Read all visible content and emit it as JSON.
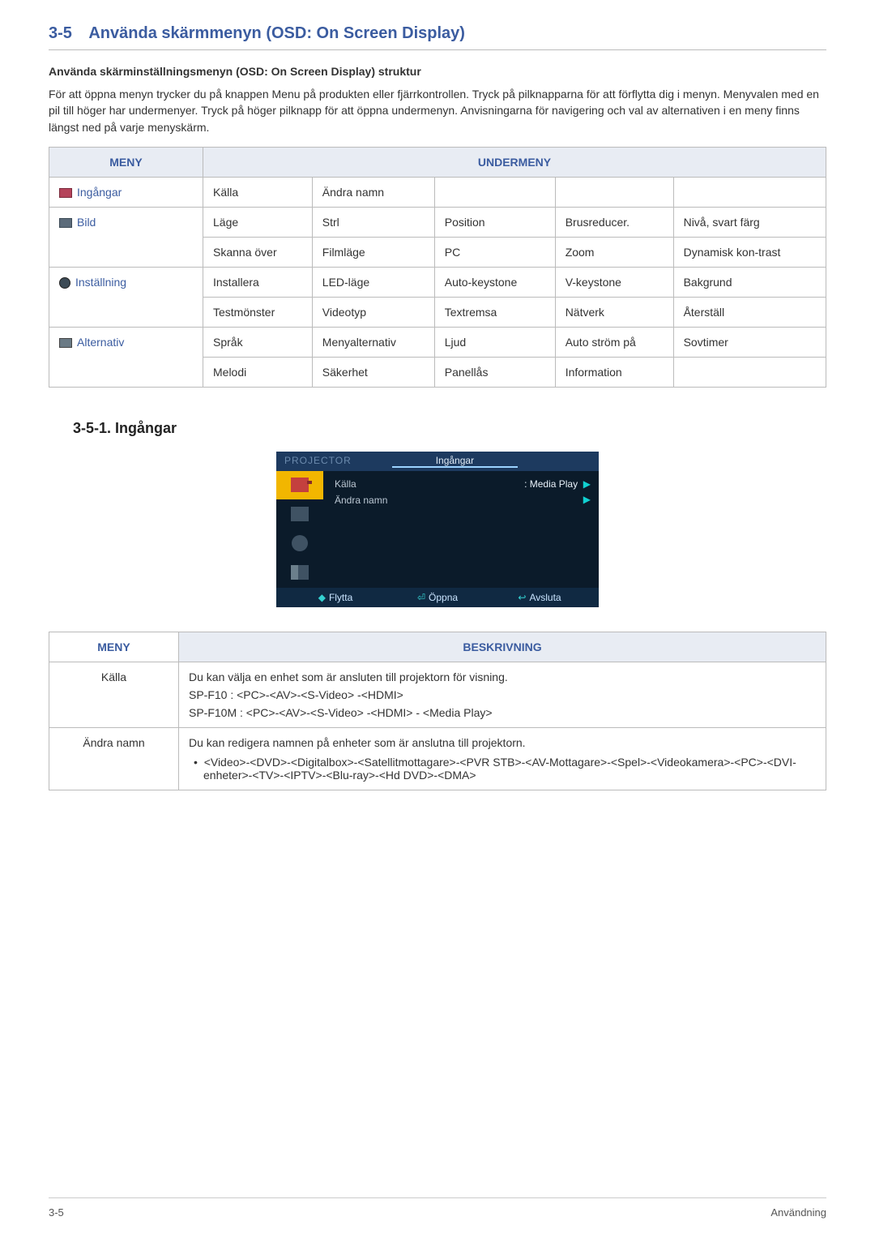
{
  "header": {
    "section_num": "3-5",
    "title": "Använda skärmmenyn (OSD: On Screen Display)"
  },
  "intro": {
    "sub_heading": "Använda skärminställningsmenyn (OSD: On Screen Display) struktur",
    "paragraph": "För att öppna menyn trycker du på knappen Menu på produkten eller fjärrkontrollen. Tryck på pilknapparna för att förflytta dig i menyn. Menyvalen med en pil till höger har undermenyer. Tryck på höger pilknapp för att öppna undermenyn. Anvisningarna för navigering och val av alternativen i en meny finns längst ned på varje menyskärm."
  },
  "table1": {
    "col_menu": "MENY",
    "col_sub": "UNDERMENY",
    "rows": [
      {
        "menu": "Ingångar",
        "c": [
          "Källa",
          "Ändra namn",
          "",
          "",
          ""
        ]
      },
      {
        "menu": "Bild",
        "c": [
          "Läge",
          "Strl",
          "Position",
          "Brusreducer.",
          "Nivå, svart färg"
        ]
      },
      {
        "menu": "",
        "c": [
          "Skanna över",
          "Filmläge",
          "PC",
          "Zoom",
          "Dynamisk kon-trast"
        ]
      },
      {
        "menu": "Inställning",
        "c": [
          "Installera",
          "LED-läge",
          "Auto-keystone",
          "V-keystone",
          "Bakgrund"
        ]
      },
      {
        "menu": "",
        "c": [
          "Testmönster",
          "Videotyp",
          "Textremsa",
          "Nätverk",
          "Återställ"
        ]
      },
      {
        "menu": "Alternativ",
        "c": [
          "Språk",
          "Menyalternativ",
          "Ljud",
          "Auto ström på",
          "Sovtimer"
        ]
      },
      {
        "menu": "",
        "c": [
          "Melodi",
          "Säkerhet",
          "Panellås",
          "Information",
          ""
        ]
      }
    ]
  },
  "section2": {
    "heading": "3-5-1. Ingångar"
  },
  "osd": {
    "projector": "PROJECTOR",
    "tab": "Ingångar",
    "line1_label": "Källa",
    "line1_value": ": Media Play",
    "line2_label": "Ändra namn",
    "foot_move": "Flytta",
    "foot_open": "Öppna",
    "foot_exit": "Avsluta"
  },
  "table2": {
    "col_menu": "MENY",
    "col_desc": "BESKRIVNING",
    "rows": [
      {
        "menu": "Källa",
        "lines": [
          "Du kan välja en enhet som är ansluten till projektorn för visning.",
          "SP-F10 : <PC>-<AV>-<S-Video> -<HDMI>",
          "SP-F10M : <PC>-<AV>-<S-Video> -<HDMI> - <Media Play>"
        ]
      },
      {
        "menu": "Ändra namn",
        "lines": [
          "Du kan redigera namnen på enheter som är anslutna till projektorn."
        ],
        "bullet": "<Video>-<DVD>-<Digitalbox>-<Satellitmottagare>-<PVR STB>-<AV-Mottagare>-<Spel>-<Videokamera>-<PC>-<DVI-enheter>-<TV>-<IPTV>-<Blu-ray>-<Hd DVD>-<DMA>"
      }
    ]
  },
  "footer": {
    "left": "3-5",
    "right": "Användning"
  }
}
